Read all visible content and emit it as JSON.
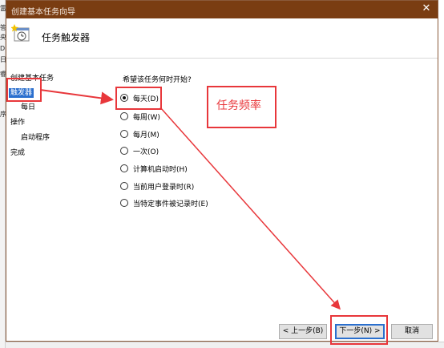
{
  "background": {
    "left_strip_chars": [
      "雷",
      "答",
      "央",
      "D",
      "日",
      "睿",
      "序"
    ]
  },
  "window": {
    "title": "创建基本任务向导",
    "close_glyph": "✕"
  },
  "header": {
    "title": "任务触发器",
    "icon": "task-clock-icon"
  },
  "nav": [
    {
      "label": "创建基本任务",
      "active": false,
      "indent": false
    },
    {
      "label": "触发器",
      "active": true,
      "indent": false
    },
    {
      "label": "每日",
      "active": false,
      "indent": true
    },
    {
      "label": "操作",
      "active": false,
      "indent": false
    },
    {
      "label": "启动程序",
      "active": false,
      "indent": true
    },
    {
      "label": "完成",
      "active": false,
      "indent": false
    }
  ],
  "question": "希望该任务何时开始?",
  "options": [
    {
      "label": "每天(D)",
      "checked": true
    },
    {
      "label": "每周(W)",
      "checked": false
    },
    {
      "label": "每月(M)",
      "checked": false
    },
    {
      "label": "一次(O)",
      "checked": false
    },
    {
      "label": "计算机启动时(H)",
      "checked": false
    },
    {
      "label": "当前用户登录时(R)",
      "checked": false
    },
    {
      "label": "当特定事件被记录时(E)",
      "checked": false
    }
  ],
  "buttons": {
    "back": "< 上一步(B)",
    "next": "下一步(N) >",
    "cancel": "取消"
  },
  "annotation": {
    "text": "任务频率",
    "color": "#e8373b"
  },
  "colors": {
    "titlebar": "#7a3d12",
    "selection": "#2a6fce",
    "annotation": "#e8373b"
  }
}
